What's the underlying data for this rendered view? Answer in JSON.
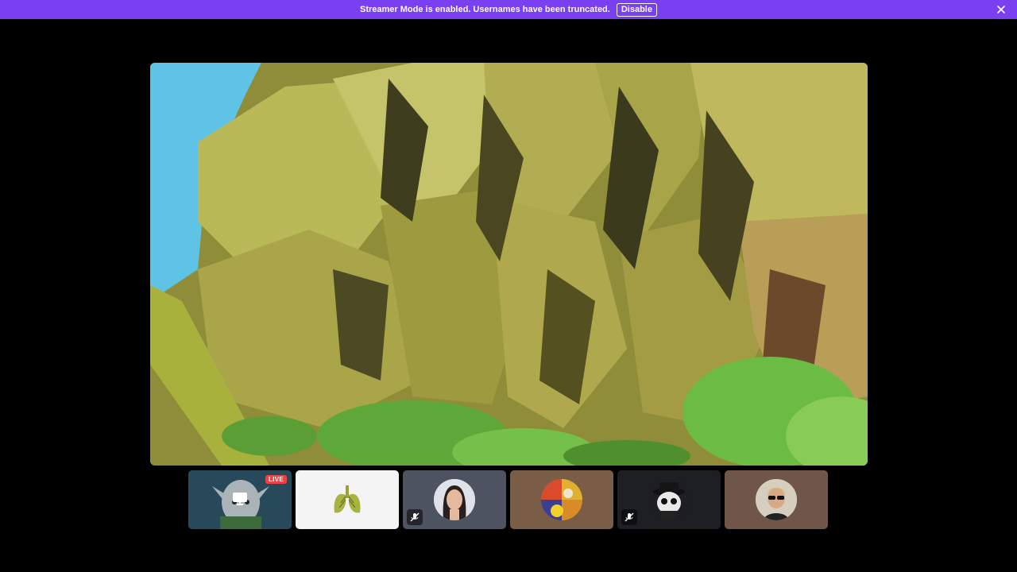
{
  "banner": {
    "message": "Streamer Mode is enabled. Usernames have been truncated.",
    "button_label": "Disable",
    "close_icon": "close-icon",
    "color": "#7b3ff2"
  },
  "stage": {
    "content": "stream-video",
    "palette": [
      "#5ec3e4",
      "#a9ac4a",
      "#6b6a2c",
      "#3b3a1c",
      "#7fc04a"
    ]
  },
  "participants": [
    {
      "id": "p1",
      "tile_bg": "#2b4a5a",
      "live_label": "LIVE",
      "streaming": true,
      "icon": "screen-share-icon"
    },
    {
      "id": "p2",
      "tile_bg": "#f4f4f4",
      "avatar": "lungs-avatar"
    },
    {
      "id": "p3",
      "tile_bg": "#4e5361",
      "avatar": "woman-portrait-avatar",
      "muted": true,
      "mute_icon": "mic-muted-icon"
    },
    {
      "id": "p4",
      "tile_bg": "#7a5d46",
      "avatar": "sports-collage-avatar"
    },
    {
      "id": "p5",
      "tile_bg": "#1e1f22",
      "avatar": "hat-character-avatar",
      "muted": true,
      "mute_icon": "mic-muted-icon"
    },
    {
      "id": "p6",
      "tile_bg": "#6f5648",
      "avatar": "man-sunglasses-avatar"
    }
  ]
}
